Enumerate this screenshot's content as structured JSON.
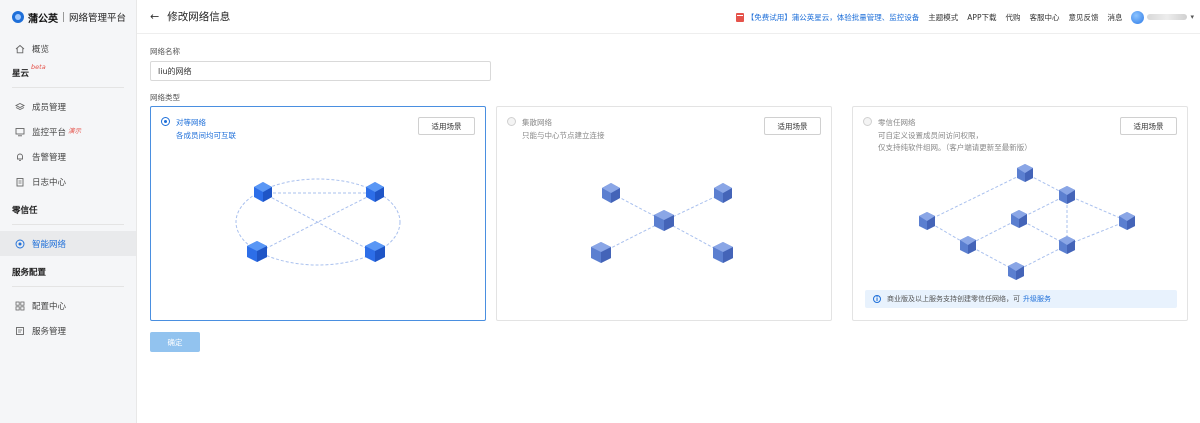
{
  "app": {
    "brand": "蒲公英",
    "product": "网络管理平台"
  },
  "sidebar": {
    "overview": "概览",
    "section_xingyun": {
      "title": "星云",
      "tag": "beta"
    },
    "members": "成员管理",
    "monitor": {
      "label": "监控平台",
      "tag": "演示"
    },
    "alerts": "告警管理",
    "logs": "日志中心",
    "section_zerotrust": "零信任",
    "smart_network": "智能网络",
    "section_service": "服务配置",
    "config_center": "配置中心",
    "service_mgmt": "服务管理"
  },
  "header": {
    "title": "修改网络信息",
    "promo": "【免费试用】蒲公英星云，体验批量管理、监控设备",
    "links": [
      "主题模式",
      "APP下载",
      "代购",
      "客服中心",
      "意见反馈",
      "消息"
    ]
  },
  "form": {
    "name_label": "网络名称",
    "name_value": "liu的网络",
    "type_label": "网络类型",
    "confirm": "确定"
  },
  "cards": [
    {
      "title": "对等网络",
      "desc": [
        "各成员间均可互联"
      ],
      "button": "适用场景",
      "selected": true
    },
    {
      "title": "集散网络",
      "desc": [
        "只能与中心节点建立连接"
      ],
      "button": "适用场景",
      "selected": false
    },
    {
      "title": "零信任网络",
      "desc": [
        "可自定义设置成员间访问权限，",
        "仅支持纯软件组网。（客户端请更新至最新版）"
      ],
      "button": "适用场景",
      "selected": false,
      "notice": {
        "text": "商业版及以上服务支持创建零信任网络，可",
        "link": "升级服务"
      }
    }
  ],
  "colors": {
    "accent": "#1e6fd9",
    "card_selected_border": "#4a8fe0",
    "confirm_disabled": "#92c3ef"
  }
}
